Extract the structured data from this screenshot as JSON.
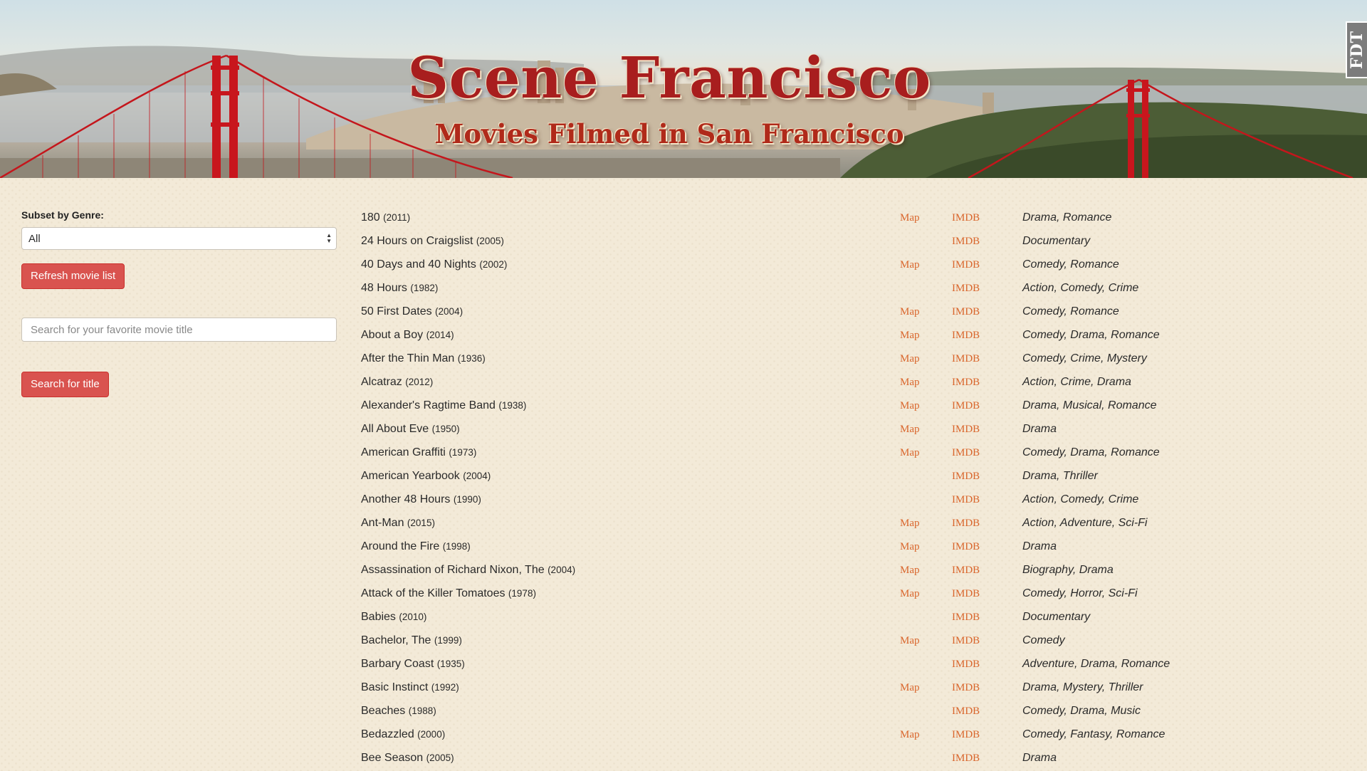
{
  "header": {
    "title": "Scene Francisco",
    "subtitle": "Movies Filmed in San Francisco",
    "badge": "FDT"
  },
  "sidebar": {
    "genre_label": "Subset by Genre:",
    "genre_selected": "All",
    "refresh_label": "Refresh movie list",
    "search_placeholder": "Search for your favorite movie title",
    "search_button_label": "Search for title"
  },
  "links": {
    "map": "Map",
    "imdb": "IMDB"
  },
  "movies": [
    {
      "title": "180",
      "year": "(2011)",
      "map": true,
      "genres": "Drama, Romance"
    },
    {
      "title": "24 Hours on Craigslist",
      "year": "(2005)",
      "map": false,
      "genres": "Documentary"
    },
    {
      "title": "40 Days and 40 Nights",
      "year": "(2002)",
      "map": true,
      "genres": "Comedy, Romance"
    },
    {
      "title": "48 Hours",
      "year": "(1982)",
      "map": false,
      "genres": "Action, Comedy, Crime"
    },
    {
      "title": "50 First Dates",
      "year": "(2004)",
      "map": true,
      "genres": "Comedy, Romance"
    },
    {
      "title": "About a Boy",
      "year": "(2014)",
      "map": true,
      "genres": "Comedy, Drama, Romance"
    },
    {
      "title": "After the Thin Man",
      "year": "(1936)",
      "map": true,
      "genres": "Comedy, Crime, Mystery"
    },
    {
      "title": "Alcatraz",
      "year": "(2012)",
      "map": true,
      "genres": "Action, Crime, Drama"
    },
    {
      "title": "Alexander's Ragtime Band",
      "year": "(1938)",
      "map": true,
      "genres": "Drama, Musical, Romance"
    },
    {
      "title": "All About Eve",
      "year": "(1950)",
      "map": true,
      "genres": "Drama"
    },
    {
      "title": "American Graffiti",
      "year": "(1973)",
      "map": true,
      "genres": "Comedy, Drama, Romance"
    },
    {
      "title": "American Yearbook",
      "year": "(2004)",
      "map": false,
      "genres": "Drama, Thriller"
    },
    {
      "title": "Another 48 Hours",
      "year": "(1990)",
      "map": false,
      "genres": "Action, Comedy, Crime"
    },
    {
      "title": "Ant-Man",
      "year": "(2015)",
      "map": true,
      "genres": "Action, Adventure, Sci-Fi"
    },
    {
      "title": "Around the Fire",
      "year": "(1998)",
      "map": true,
      "genres": "Drama"
    },
    {
      "title": "Assassination of Richard Nixon, The",
      "year": "(2004)",
      "map": true,
      "genres": "Biography, Drama"
    },
    {
      "title": "Attack of the Killer Tomatoes",
      "year": "(1978)",
      "map": true,
      "genres": "Comedy, Horror, Sci-Fi"
    },
    {
      "title": "Babies",
      "year": "(2010)",
      "map": false,
      "genres": "Documentary"
    },
    {
      "title": "Bachelor, The",
      "year": "(1999)",
      "map": true,
      "genres": "Comedy"
    },
    {
      "title": "Barbary Coast",
      "year": "(1935)",
      "map": false,
      "genres": "Adventure, Drama, Romance"
    },
    {
      "title": "Basic Instinct",
      "year": "(1992)",
      "map": true,
      "genres": "Drama, Mystery, Thriller"
    },
    {
      "title": "Beaches",
      "year": "(1988)",
      "map": false,
      "genres": "Comedy, Drama, Music"
    },
    {
      "title": "Bedazzled",
      "year": "(2000)",
      "map": true,
      "genres": "Comedy, Fantasy, Romance"
    },
    {
      "title": "Bee Season",
      "year": "(2005)",
      "map": false,
      "genres": "Drama"
    }
  ]
}
